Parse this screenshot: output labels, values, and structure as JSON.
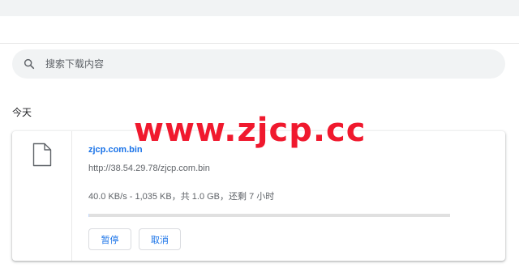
{
  "search": {
    "placeholder": "搜索下载内容",
    "icon": "search-icon"
  },
  "section": {
    "title": "今天"
  },
  "download": {
    "file_icon": "file-icon",
    "file_name": "zjcp.com.bin",
    "url": "http://38.54.29.78/zjcp.com.bin",
    "status": "40.0 KB/s - 1,035 KB，共 1.0 GB，还剩 7 小时",
    "progress": 0.001,
    "pause_label": "暂停",
    "cancel_label": "取消"
  },
  "watermark": {
    "text": "www.zjcp.cc"
  },
  "colors": {
    "accent": "#1a73e8",
    "watermark": "#f0192e",
    "search_bg": "#f1f3f4"
  }
}
